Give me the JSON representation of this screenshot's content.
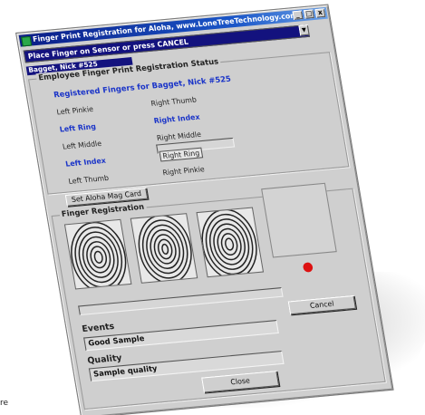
{
  "window": {
    "title": "Finger Print Registration for Aloha, www.LoneTreeTechnology.com",
    "min_label": "_",
    "max_label": "□",
    "close_label": "x"
  },
  "prompt": {
    "text": "Place Finger on Sensor or press CANCEL"
  },
  "employee": {
    "selected": "Bagget, Nick #525",
    "status_title": "Employee Finger Print Registration Status",
    "registered_heading": "Registered Fingers for Bagget, Nick #525",
    "fingers": [
      {
        "label": "Left Pinkie",
        "registered": false
      },
      {
        "label": "Right Thumb",
        "registered": false
      },
      {
        "label": "Left Ring",
        "registered": true
      },
      {
        "label": "Right Index",
        "registered": true
      },
      {
        "label": "Left Middle",
        "registered": false
      },
      {
        "label": "Right Middle",
        "registered": false
      },
      {
        "label": "Left Index",
        "registered": true
      },
      {
        "label": "Right Ring",
        "registered": false
      },
      {
        "label": "Left Thumb",
        "registered": false
      },
      {
        "label": "Right Pinkie",
        "registered": false
      }
    ],
    "mag_card_button": "Set Aloha Mag Card"
  },
  "registration": {
    "title": "Finger Registration",
    "sample_count": 3
  },
  "events": {
    "label": "Events",
    "value": "Good Sample"
  },
  "quality": {
    "label": "Quality",
    "value": "Sample quality"
  },
  "buttons": {
    "cancel": "Cancel",
    "close": "Close"
  },
  "footer_text": "re",
  "colors": {
    "title_bar": "#0b1d86",
    "prompt_bg": "#13127e",
    "registered_text": "#1a34c8",
    "status_dot": "#dd1111",
    "window_bg": "#cfcfcf"
  }
}
